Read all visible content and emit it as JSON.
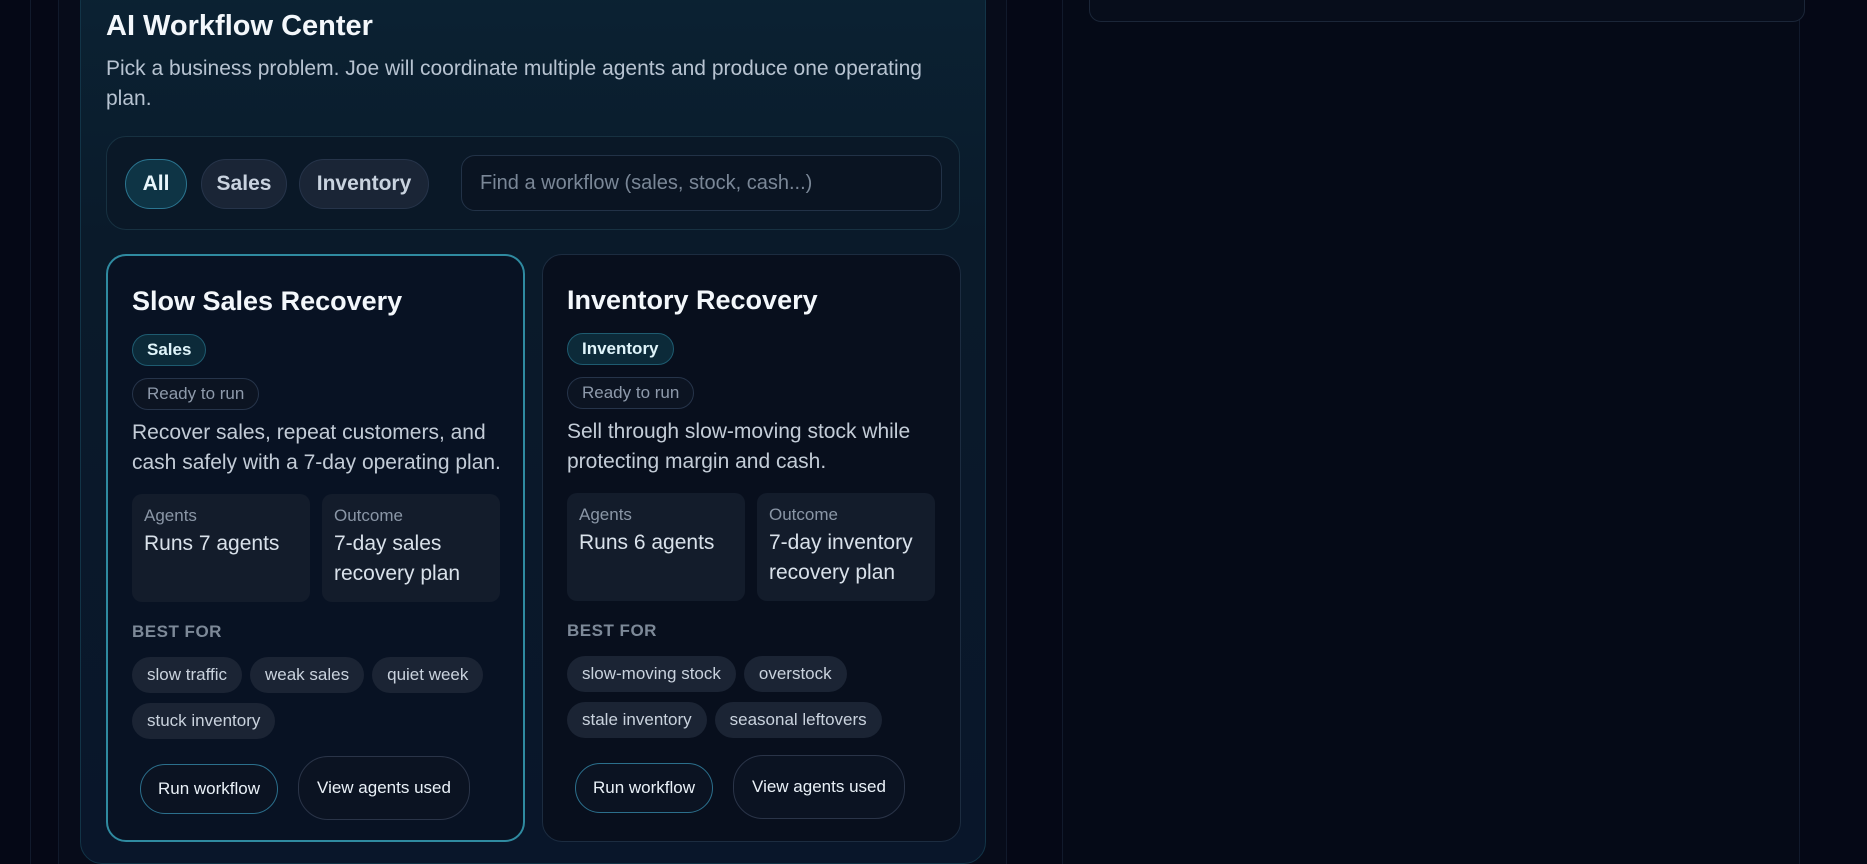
{
  "panel": {
    "title": "AI Workflow Center",
    "subtitle": "Pick a business problem. Joe will coordinate multiple agents and produce one operating plan."
  },
  "filters": {
    "chips": [
      {
        "label": "All",
        "active": true
      },
      {
        "label": "Sales",
        "active": false
      },
      {
        "label": "Inventory",
        "active": false
      }
    ],
    "search_placeholder": "Find a workflow (sales, stock, cash...)"
  },
  "cards": [
    {
      "title": "Slow Sales Recovery",
      "category": "Sales",
      "status": "Ready to run",
      "description": "Recover sales, repeat customers, and cash safely with a 7-day operating plan.",
      "agents_label": "Agents",
      "agents_value": "Runs 7 agents",
      "outcome_label": "Outcome",
      "outcome_value": "7-day sales recovery plan",
      "best_for_label": "BEST FOR",
      "tags": [
        "slow traffic",
        "weak sales",
        "quiet week",
        "stuck inventory"
      ],
      "run_label": "Run workflow",
      "view_label": "View agents used",
      "selected": true
    },
    {
      "title": "Inventory Recovery",
      "category": "Inventory",
      "status": "Ready to run",
      "description": "Sell through slow-moving stock while protecting margin and cash.",
      "agents_label": "Agents",
      "agents_value": "Runs 6 agents",
      "outcome_label": "Outcome",
      "outcome_value": "7-day inventory recovery plan",
      "best_for_label": "BEST FOR",
      "tags": [
        "slow-moving stock",
        "overstock",
        "stale inventory",
        "seasonal leftovers"
      ],
      "run_label": "Run workflow",
      "view_label": "View agents used",
      "selected": false
    }
  ],
  "colors": {
    "background": "#050816",
    "accent": "#2f8aa0",
    "active_chip": "#0e3445"
  }
}
